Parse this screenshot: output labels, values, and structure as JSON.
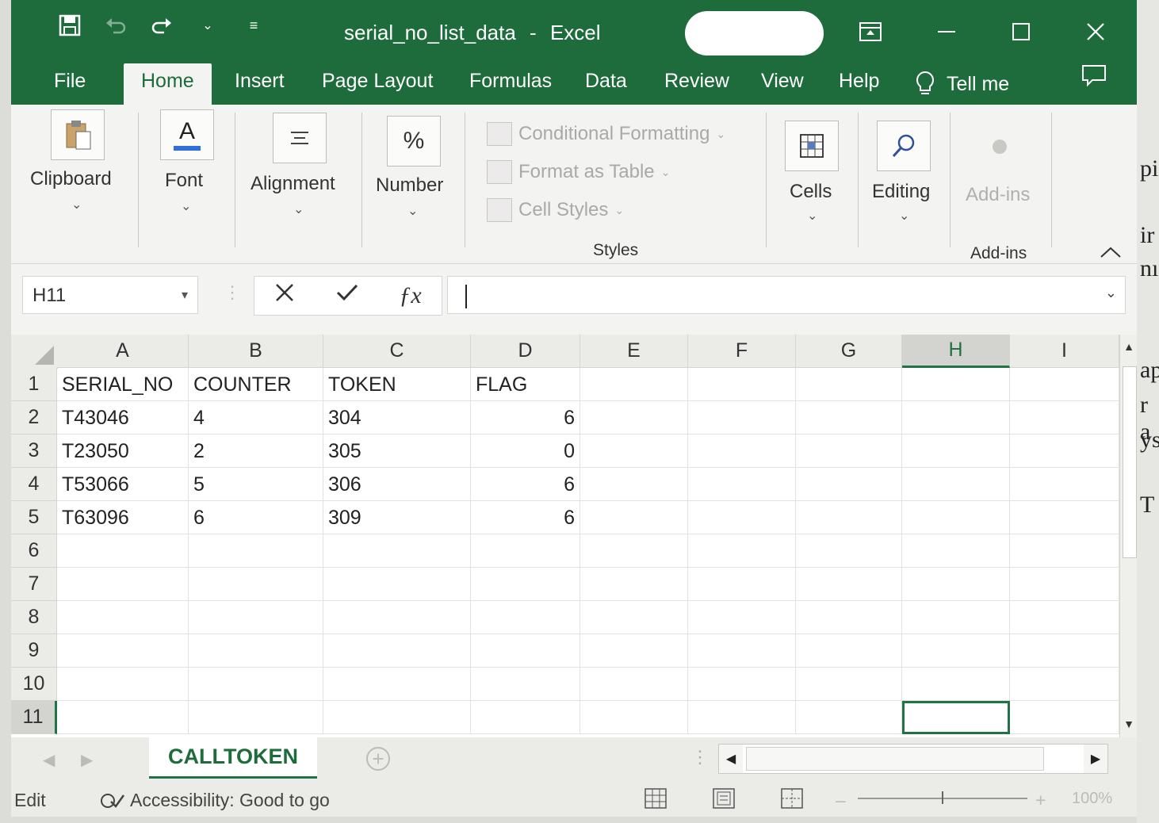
{
  "window": {
    "title_doc": "serial_no_list_data",
    "title_sep": "-",
    "title_app": "Excel"
  },
  "qat": {
    "save_icon": "save-icon",
    "undo_icon": "undo-icon",
    "redo_icon": "redo-icon"
  },
  "tabs": [
    {
      "label": "File"
    },
    {
      "label": "Home"
    },
    {
      "label": "Insert"
    },
    {
      "label": "Page Layout"
    },
    {
      "label": "Formulas"
    },
    {
      "label": "Data"
    },
    {
      "label": "Review"
    },
    {
      "label": "View"
    },
    {
      "label": "Help"
    },
    {
      "label": "Tell me"
    }
  ],
  "ribbon": {
    "clipboard": "Clipboard",
    "font": "Font",
    "alignment": "Alignment",
    "number": "Number",
    "number_glyph": "%",
    "font_glyph": "A",
    "conditional_formatting": "Conditional Formatting",
    "format_as_table": "Format as Table",
    "cell_styles": "Cell Styles",
    "styles": "Styles",
    "cells": "Cells",
    "editing": "Editing",
    "addins": "Add-ins",
    "addins_group": "Add-ins"
  },
  "formula_bar": {
    "name_box": "H11",
    "formula": ""
  },
  "columns": [
    "A",
    "B",
    "C",
    "D",
    "E",
    "F",
    "G",
    "H",
    "I"
  ],
  "rows": [
    "1",
    "2",
    "3",
    "4",
    "5",
    "6",
    "7",
    "8",
    "9",
    "10",
    "11"
  ],
  "sheet": {
    "headers": [
      "SERIAL_NO",
      "COUNTER",
      "TOKEN",
      "FLAG"
    ],
    "data": [
      [
        "T43046",
        "4",
        "304",
        "6"
      ],
      [
        "T23050",
        "2",
        "305",
        "0"
      ],
      [
        "T53066",
        "5",
        "306",
        "6"
      ],
      [
        "T63096",
        "6",
        "309",
        "6"
      ]
    ]
  },
  "sheet_tabs": [
    {
      "label": "CALLTOKEN"
    }
  ],
  "status": {
    "mode": "Edit",
    "accessibility": "Accessibility: Good to go",
    "zoom": "100%"
  },
  "edge_text": [
    "pi",
    "ir",
    "nı",
    "ap",
    "r a",
    "ys",
    "T"
  ],
  "colors": {
    "excel_green": "#1e6b3c",
    "selection_green": "#217346"
  }
}
